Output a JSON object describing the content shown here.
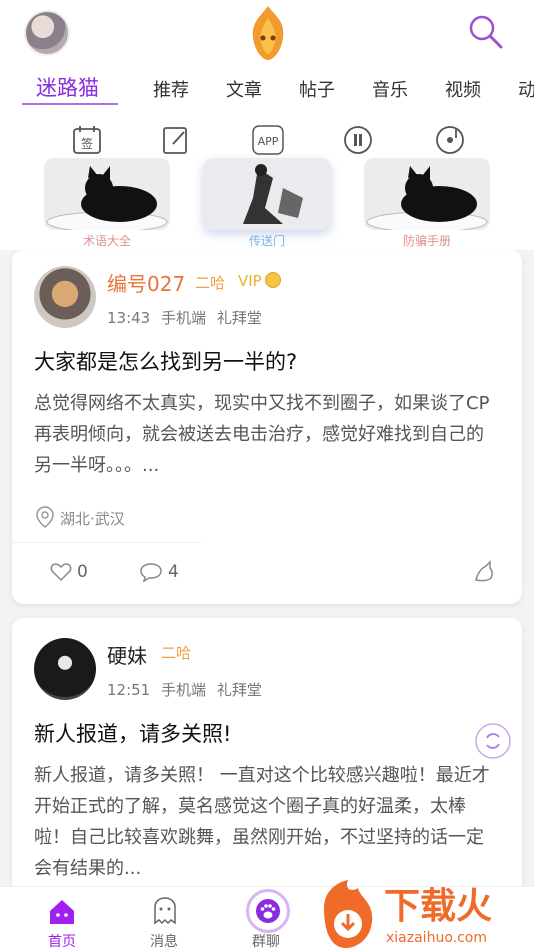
{
  "tabs": [
    {
      "label": "迷路猫",
      "active": true
    },
    {
      "label": "推荐"
    },
    {
      "label": "文章"
    },
    {
      "label": "帖子"
    },
    {
      "label": "音乐"
    },
    {
      "label": "视频"
    },
    {
      "label": "动"
    }
  ],
  "shortcuts": {
    "icons": [
      {
        "name": "calendar-sign-icon",
        "text": "签"
      },
      {
        "name": "edit-note-icon"
      },
      {
        "name": "app-icon",
        "text": "APP"
      },
      {
        "name": "music-disc-icon"
      },
      {
        "name": "record-icon"
      }
    ],
    "banners": [
      {
        "label": "术语大全"
      },
      {
        "label": "传送门"
      },
      {
        "label": "防骗手册"
      }
    ]
  },
  "posts": [
    {
      "username": "编号027",
      "level": "二哈",
      "vip": "VIP",
      "time": "13:43",
      "device": "手机端",
      "channel": "礼拜堂",
      "title": "大家都是怎么找到另一半的?",
      "body": "总觉得网络不太真实，现实中又找不到圈子，如果谈了CP再表明倾向，就会被送去电击治疗，感觉好难找到自己的另一半呀。。。...",
      "location": "湖北·武汉",
      "likes": "0",
      "comments": "4"
    },
    {
      "username": "硬妹",
      "level": "二哈",
      "time": "12:51",
      "device": "手机端",
      "channel": "礼拜堂",
      "title": "新人报道，请多关照!",
      "body": "新人报道，请多关照！ 一直对这个比较感兴趣啦！最近才开始正式的了解，莫名感觉这个圈子真的好温柔，太棒啦！自己比较喜欢跳舞，虽然刚开始，不过坚持的话一定会有结果的..."
    }
  ],
  "bottom_nav": [
    {
      "label": "首页",
      "icon": "home-icon",
      "active": true
    },
    {
      "label": "消息",
      "icon": "ghost-message-icon"
    },
    {
      "label": "群聊",
      "icon": "paw-icon"
    }
  ],
  "watermark": {
    "brand": "下载火",
    "url": "xiazaihuo.com"
  },
  "colors": {
    "accent": "#8a2be2",
    "level": "#f0a040",
    "orange_name": "#e8743b"
  }
}
